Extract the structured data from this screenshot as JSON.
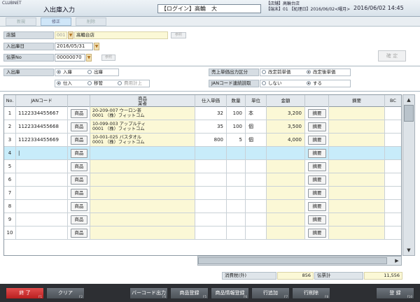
{
  "titlebar": {
    "brand": "CLUBNET",
    "title": "入出庫入力",
    "login": "【ログイン】高輪　大",
    "store_line1": "【店舗】高輪台店",
    "store_line2": "【端末】01 【処理日】2016/06/02<曜月>",
    "datetime": "2016/06/02 14:45"
  },
  "mode_tabs": [
    "新規",
    "修正",
    "削除"
  ],
  "form": {
    "store_label": "店舗",
    "store_code": "001",
    "store_name": "高輪台店",
    "store_ref_btn": "参照",
    "date_label": "入出庫日",
    "date_value": "2016/05/31",
    "slip_label": "伝票No",
    "slip_value": "00000070",
    "slip_ref_btn": "参照",
    "confirm_btn": "確 定"
  },
  "options": {
    "inout_label": "入出庫",
    "in": "入庫",
    "out": "出庫",
    "purchase": "仕入",
    "transfer": "移管",
    "expense": "費用計上",
    "price_label": "売上単価出力区分",
    "price_before": "改定前単価",
    "price_after": "改定後単価",
    "jan_label": "JANコード連続読取",
    "jan_no": "しない",
    "jan_yes": "する"
  },
  "grid": {
    "headers": {
      "no": "No.",
      "jan": "JANコード",
      "product": "商品",
      "maker": "業者",
      "price": "仕入単価",
      "qty": "数量",
      "unit": "単位",
      "amount": "金額",
      "memo": "摘要",
      "bc": "BC"
    },
    "item_btn": "商品",
    "memo_btn": "摘要",
    "rows": [
      {
        "no": "1",
        "jan": "1122334455667",
        "line1": "20-209-007 ウーロン茶",
        "line2": "0001 （株）フィットコム",
        "price": "32",
        "qty": "100",
        "unit": "本",
        "amount": "3,200"
      },
      {
        "no": "2",
        "jan": "1122334455668",
        "line1": "10-099-003 アップルティ",
        "line2": "0001 （株）フィットコム",
        "price": "35",
        "qty": "100",
        "unit": "個",
        "amount": "3,500"
      },
      {
        "no": "3",
        "jan": "1122334455669",
        "line1": "10-001-025 バスタオル",
        "line2": "0001 （株）フィットコム",
        "price": "800",
        "qty": "5",
        "unit": "個",
        "amount": "4,000"
      },
      {
        "no": "4",
        "jan": "|",
        "line1": "",
        "line2": "",
        "price": "",
        "qty": "",
        "unit": "",
        "amount": ""
      },
      {
        "no": "5",
        "jan": "",
        "line1": "",
        "line2": "",
        "price": "",
        "qty": "",
        "unit": "",
        "amount": ""
      },
      {
        "no": "6",
        "jan": "",
        "line1": "",
        "line2": "",
        "price": "",
        "qty": "",
        "unit": "",
        "amount": ""
      },
      {
        "no": "7",
        "jan": "",
        "line1": "",
        "line2": "",
        "price": "",
        "qty": "",
        "unit": "",
        "amount": ""
      },
      {
        "no": "8",
        "jan": "",
        "line1": "",
        "line2": "",
        "price": "",
        "qty": "",
        "unit": "",
        "amount": ""
      },
      {
        "no": "9",
        "jan": "",
        "line1": "",
        "line2": "",
        "price": "",
        "qty": "",
        "unit": "",
        "amount": ""
      },
      {
        "no": "10",
        "jan": "",
        "line1": "",
        "line2": "",
        "price": "",
        "qty": "",
        "unit": "",
        "amount": ""
      }
    ]
  },
  "totals": {
    "tax_label": "消費税(外)",
    "tax_value": "856",
    "total_label": "伝票計",
    "total_value": "11,556"
  },
  "footer": {
    "end": "終 了",
    "end_key": "F1",
    "clear": "クリア",
    "clear_key": "F2",
    "barcode": "バーコード出力",
    "barcode_key": "F4",
    "item_reg": "商品登録",
    "item_reg_key": "F5",
    "item_info": "商品情報登録",
    "item_info_key": "F6",
    "add_row": "行追加",
    "add_row_key": "F7",
    "del_row": "行削除",
    "del_row_key": "F8",
    "register": "登 録",
    "register_key": "F10"
  },
  "colors": {
    "selected_row": "#c8ecfa",
    "edit_cell": "#fbf8d6",
    "end_button": "#d43a3a"
  }
}
